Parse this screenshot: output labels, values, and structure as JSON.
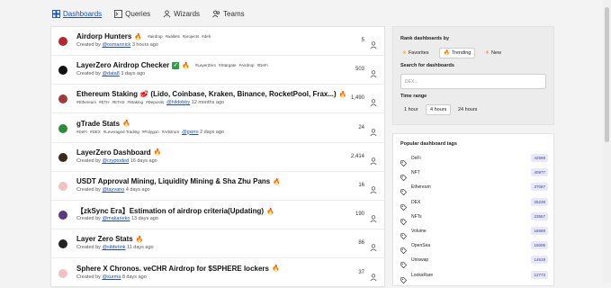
{
  "nav": {
    "dashboards": "Dashboards",
    "queries": "Queries",
    "wizards": "Wizards",
    "teams": "Teams"
  },
  "rows": [
    {
      "title": "Airdorp Hunters",
      "tags": [
        "#airdrop",
        "#wallets",
        "#projects",
        "#defi"
      ],
      "user": "@osmannick",
      "time": "3 hours ago",
      "count": "5",
      "avatar": "#b3282d"
    },
    {
      "title": "LayerZero Airdrop Checker",
      "tags": [
        "#LayerZero",
        "#Stargate",
        "#Airdrop",
        "#DeFi"
      ],
      "user": "@data8",
      "time": "3 days ago",
      "count": "503",
      "avatar": "#111111"
    },
    {
      "title": "Ethereum Staking 🥩 (Lido, Coinbase, Kraken, Binance, RocketPool, Frax...)",
      "tags": [
        "#Ethereum",
        "#ETH",
        "#ETH2",
        "#Staking",
        "#Deposits"
      ],
      "user": "@hildobby",
      "time": "12 months ago",
      "count": "1,490",
      "avatar": "#a33a3a"
    },
    {
      "title": "gTrade Stats",
      "tags": [
        "#DeFi",
        "#DEX",
        "#Leveraged Trading",
        "#Polygon",
        "#Arbitrum"
      ],
      "user": "@garro",
      "time": "2 days ago",
      "count": "24",
      "avatar": "#2f8a3a"
    },
    {
      "title": "LayerZero Dashboard",
      "tags": [],
      "user": "@cryptoded",
      "time": "16 days ago",
      "count": "2,414",
      "avatar": "#3a2a1a"
    },
    {
      "title": "USDT Approval Mining, Liquidity Mining & Sha Zhu Pans",
      "tags": [],
      "user": "@tayvano",
      "time": "4 days ago",
      "count": "16",
      "avatar": "#f2c2c2"
    },
    {
      "title": "【zkSync Era】Estimation of airdrop criteria(Updating)",
      "tags": [],
      "user": "@makarieko",
      "time": "13 days ago",
      "count": "190",
      "avatar": "#5a3a7a"
    },
    {
      "title": "Layer Zero Stats",
      "tags": [],
      "user": "@sibbrtink",
      "time": "11 days ago",
      "count": "86",
      "avatar": "#222222"
    },
    {
      "title": "Sphere X Chronos. veCHR Airdrop for $SPHERE lockers",
      "tags": [],
      "user": "@surma",
      "time": "8 days ago",
      "count": "37",
      "avatar": "#f2c2c2"
    }
  ],
  "created_by": "Created by",
  "rank": {
    "label": "Rank dashboards by",
    "options": [
      "Favorites",
      "Trending",
      "New"
    ],
    "selected": "Trending"
  },
  "search": {
    "label": "Search for dashboards",
    "placeholder": "DEX..."
  },
  "time_range": {
    "label": "Time range",
    "options": [
      "1 hour",
      "4 hours",
      "24 hours"
    ],
    "selected": "4 hours"
  },
  "popular": {
    "label": "Popular dashboard tags",
    "tags": [
      {
        "name": "DeFi",
        "count": "42569"
      },
      {
        "name": "NFT",
        "count": "40977"
      },
      {
        "name": "Ethereum",
        "count": "37067"
      },
      {
        "name": "DEX",
        "count": "25239"
      },
      {
        "name": "NFTs",
        "count": "23557"
      },
      {
        "name": "Volume",
        "count": "16669"
      },
      {
        "name": "OpenSea",
        "count": "16006"
      },
      {
        "name": "Uniswap",
        "count": "14519"
      },
      {
        "name": "LooksRare",
        "count": "12773"
      }
    ]
  },
  "colors": {
    "accent": "#1f4fa6",
    "fire": "#e8772e",
    "tag_count_bg": "#e8e8f7"
  }
}
